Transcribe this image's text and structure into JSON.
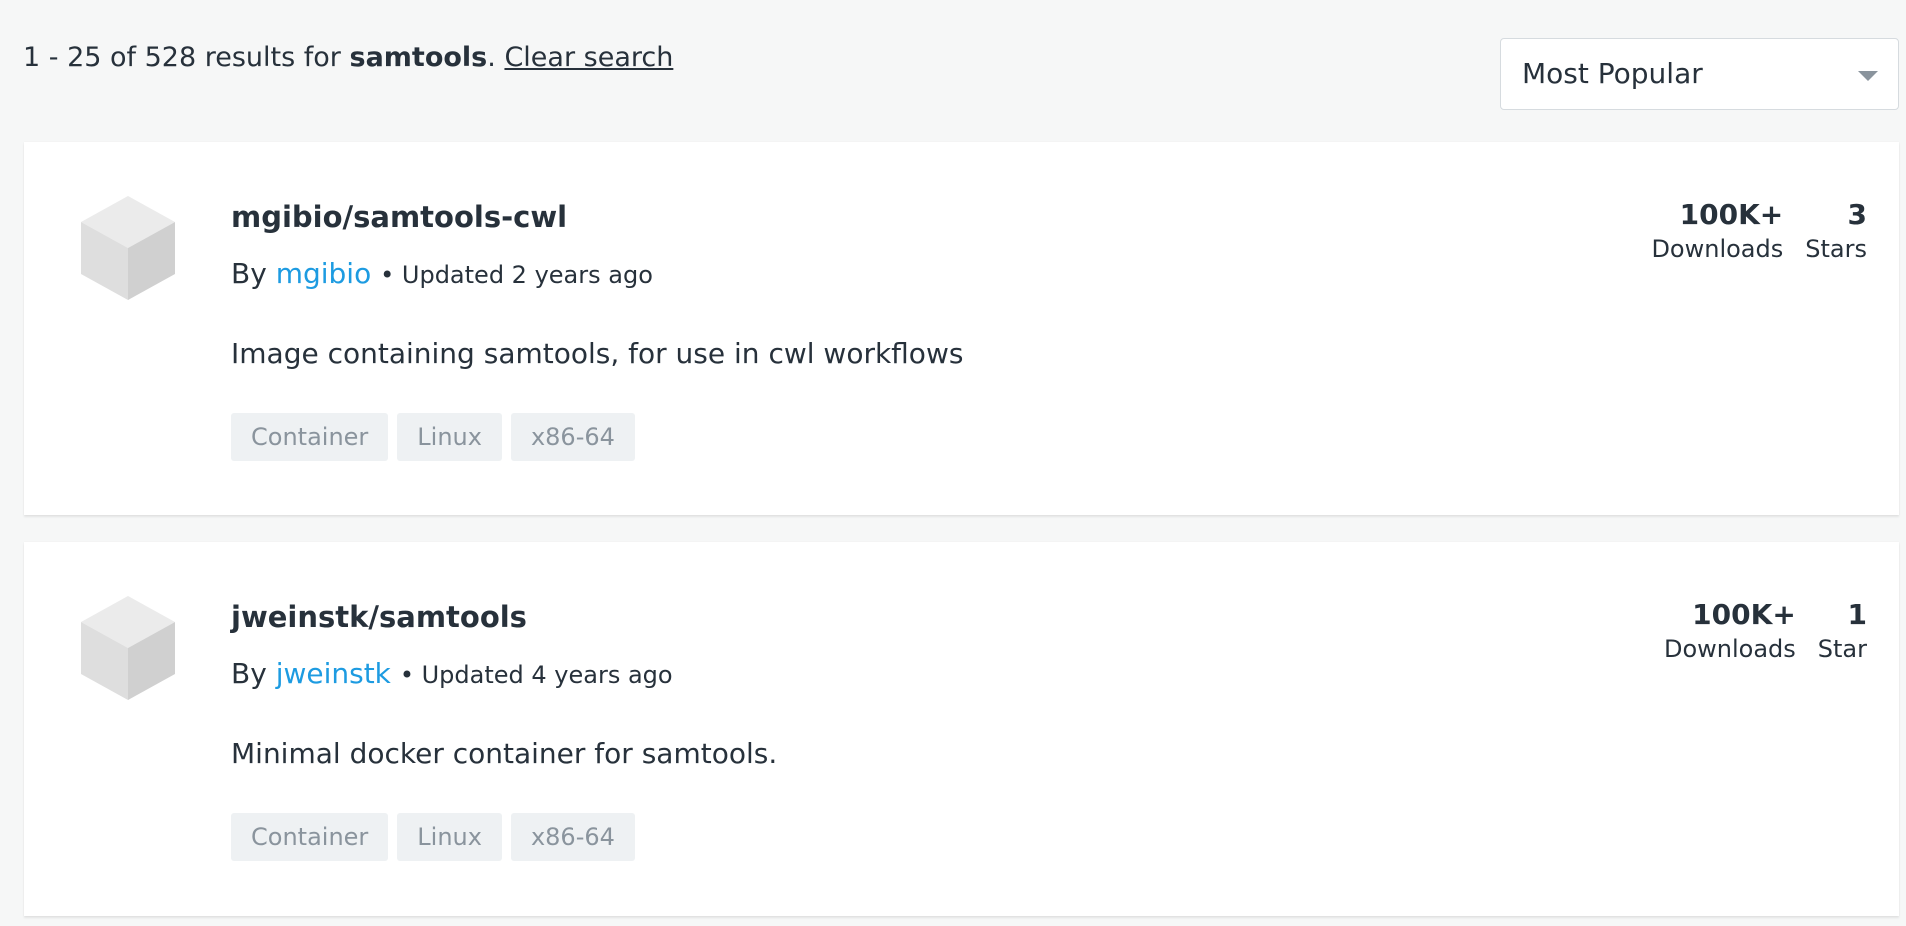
{
  "header": {
    "results_text": "1 - 25 of 528 results for ",
    "search_term": "samtools",
    "period": ".",
    "clear_search": "Clear search"
  },
  "sort": {
    "selected": "Most Popular",
    "icon": "chevron-down-icon"
  },
  "results": [
    {
      "name": "mgibio/samtools-cwl",
      "by": "By",
      "publisher": "mgibio",
      "updated": "• Updated 2 years ago",
      "description": "Image containing samtools, for use in cwl workflows",
      "tags": [
        "Container",
        "Linux",
        "x86-64"
      ],
      "downloads_value": "100K+",
      "downloads_label": "Downloads",
      "stars_value": "3",
      "stars_label": "Stars"
    },
    {
      "name": "jweinstk/samtools",
      "by": "By",
      "publisher": "jweinstk",
      "updated": "• Updated 4 years ago",
      "description": "Minimal docker container for samtools.",
      "tags": [
        "Container",
        "Linux",
        "x86-64"
      ],
      "downloads_value": "100K+",
      "downloads_label": "Downloads",
      "stars_value": "1",
      "stars_label": "Star"
    }
  ],
  "colors": {
    "background": "#f6f7f7",
    "card": "#ffffff",
    "text": "#27313b",
    "link": "#1d9be1",
    "tag_bg": "#eef1f3",
    "tag_text": "#8a949d"
  }
}
